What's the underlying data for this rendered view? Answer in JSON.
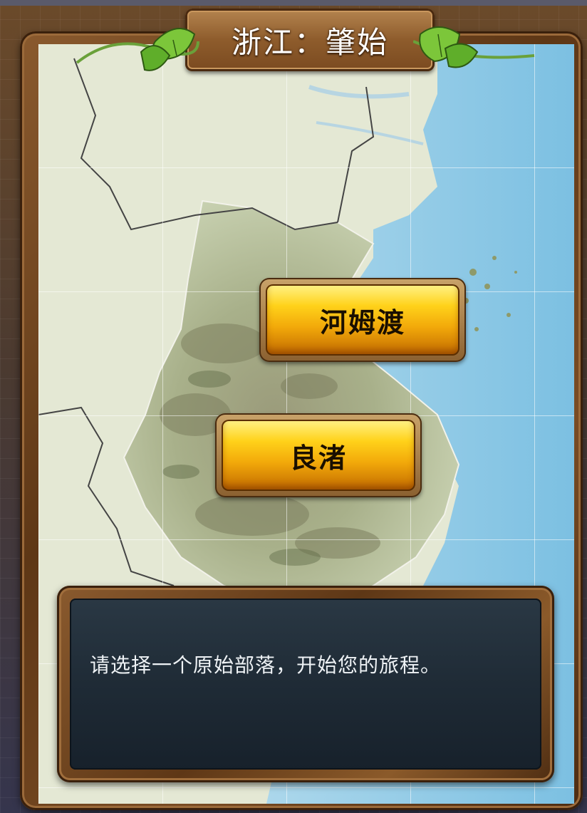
{
  "title": "浙江：肇始",
  "tribes": [
    {
      "label": "河姆渡"
    },
    {
      "label": "良渚"
    }
  ],
  "dialog": {
    "message": "请选择一个原始部落，开始您的旅程。"
  },
  "icons": [
    "leaf-vine-icon-left",
    "leaf-vine-icon-right"
  ],
  "colors": {
    "button_gold": "#ffd21a",
    "frame_wood": "#6b4222",
    "dialog_bg": "#1f2b36",
    "sea": "#9fd0e8"
  }
}
